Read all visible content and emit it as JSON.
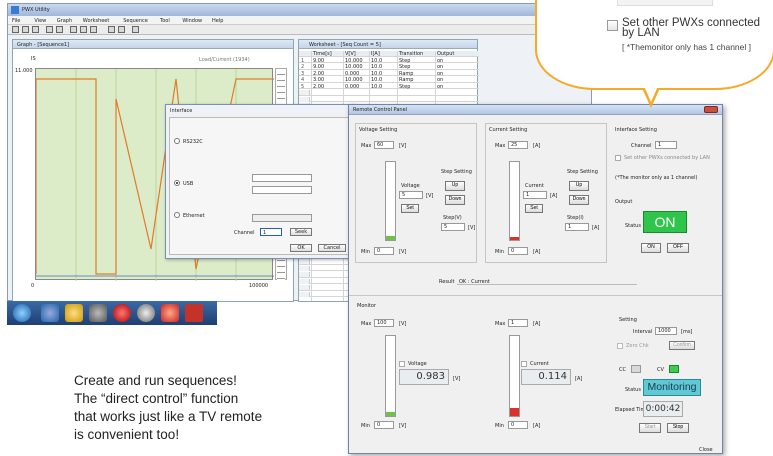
{
  "app": {
    "title": "PWX Utility",
    "menu": [
      "File",
      "View",
      "Graph",
      "Worksheet",
      "Sequence",
      "Tool",
      "Window",
      "Help"
    ],
    "graph_pane_title": "Graph - [Sequence1]",
    "graph_header_left": "IS",
    "graph_header_right": "Load/Current (1934)",
    "graph_left_axis_top": "11.000",
    "graph_x_left": "0",
    "graph_x_right": "100000",
    "table_pane_title": "Worksheet - [Seq Count = 5]",
    "table_headers": [
      "",
      "Time[s]",
      "V[V]",
      "I[A]",
      "Transition",
      "Output"
    ],
    "table_rows": [
      [
        "1",
        "9.00",
        "10.000",
        "10.0",
        "Step",
        "on"
      ],
      [
        "2",
        "9.00",
        "10.000",
        "10.0",
        "Step",
        "on"
      ],
      [
        "3",
        "2.00",
        "0.000",
        "10.0",
        "Ramp",
        "on"
      ],
      [
        "4",
        "3.00",
        "10.000",
        "10.0",
        "Ramp",
        "on"
      ],
      [
        "5",
        "2.00",
        "0.000",
        "10.0",
        "Step",
        "on"
      ]
    ],
    "colors": {
      "graph_line": "#e07b2a",
      "plot_bg": "#dcebc8"
    }
  },
  "interface_dialog": {
    "title": "Interface",
    "options": [
      "RS232C",
      "USB",
      "Ethernet"
    ],
    "channel_label": "Channel",
    "channel_value": "1",
    "seek_button": "Seek",
    "ok_button": "OK",
    "cancel_button": "Cancel"
  },
  "remote_panel": {
    "title": "Remote Control Panel",
    "voltage": {
      "section": "Voltage Setting",
      "max_label": "Max",
      "max_value": "60",
      "unit": "[V]",
      "min_label": "Min",
      "min_value": "0",
      "input_label": "Voltage",
      "input_value": "5",
      "set_button": "Set",
      "step_section": "Step Setting",
      "step_up": "Up",
      "step_down": "Down",
      "step_label": "Step(V)",
      "step_value": "5",
      "slider_level": 0.05
    },
    "current": {
      "section": "Current Setting",
      "max_label": "Max",
      "max_value": "25",
      "unit": "[A]",
      "min_label": "Min",
      "min_value": "0",
      "input_label": "Current",
      "input_value": "1",
      "set_button": "Set",
      "step_section": "Step Setting",
      "step_up": "Up",
      "step_down": "Down",
      "step_label": "Step(I)",
      "step_value": "1",
      "slider_level": 0.04
    },
    "interface": {
      "section": "Interface Setting",
      "channel_label": "Channel",
      "channel_value": "1",
      "checkbox_label": "Set other PWXs connected by LAN",
      "note": "(*The monitor only as 1 channel)"
    },
    "output": {
      "section": "Output",
      "status_label": "Status",
      "status_value": "ON",
      "on_button": "ON",
      "off_button": "OFF"
    },
    "result_label": "Result",
    "result_value": "OK : Current",
    "monitor": {
      "section": "Monitor",
      "v_max_label": "Max",
      "v_max_value": "100",
      "v_unit": "[V]",
      "v_min_label": "Min",
      "v_min_value": "0",
      "voltage_check": "Voltage",
      "voltage_value": "0.983",
      "i_max_label": "Max",
      "i_max_value": "1",
      "i_unit": "[A]",
      "i_min_label": "Min",
      "i_min_value": "0",
      "current_check": "Current",
      "current_value": "0.114",
      "v_level": 0.05,
      "i_level": 0.1
    },
    "setting": {
      "section": "Setting",
      "interval_label": "Interval",
      "interval_value": "1000",
      "interval_unit": "[ms]",
      "zero_check": "Zero Chk",
      "zero_button": "Confirm"
    },
    "mode": {
      "cc": "CC",
      "cv": "CV"
    },
    "status_label": "Status",
    "status_value": "Monitoring",
    "elapsed_label": "Elapsed Time",
    "elapsed_value": "0:00:42",
    "start_button": "Start",
    "stop_button": "Stop",
    "close_label": "Close"
  },
  "callout": {
    "checkbox_label": "Set other PWXs connected by LAN",
    "note": "[ *Themonitor only has 1 channel ]",
    "border_color": "#f7a928"
  },
  "caption": {
    "line1": "Create and run sequences!",
    "line2": "The “direct control” function",
    "line3": "that works just like a TV remote",
    "line4": "is convenient too!"
  }
}
